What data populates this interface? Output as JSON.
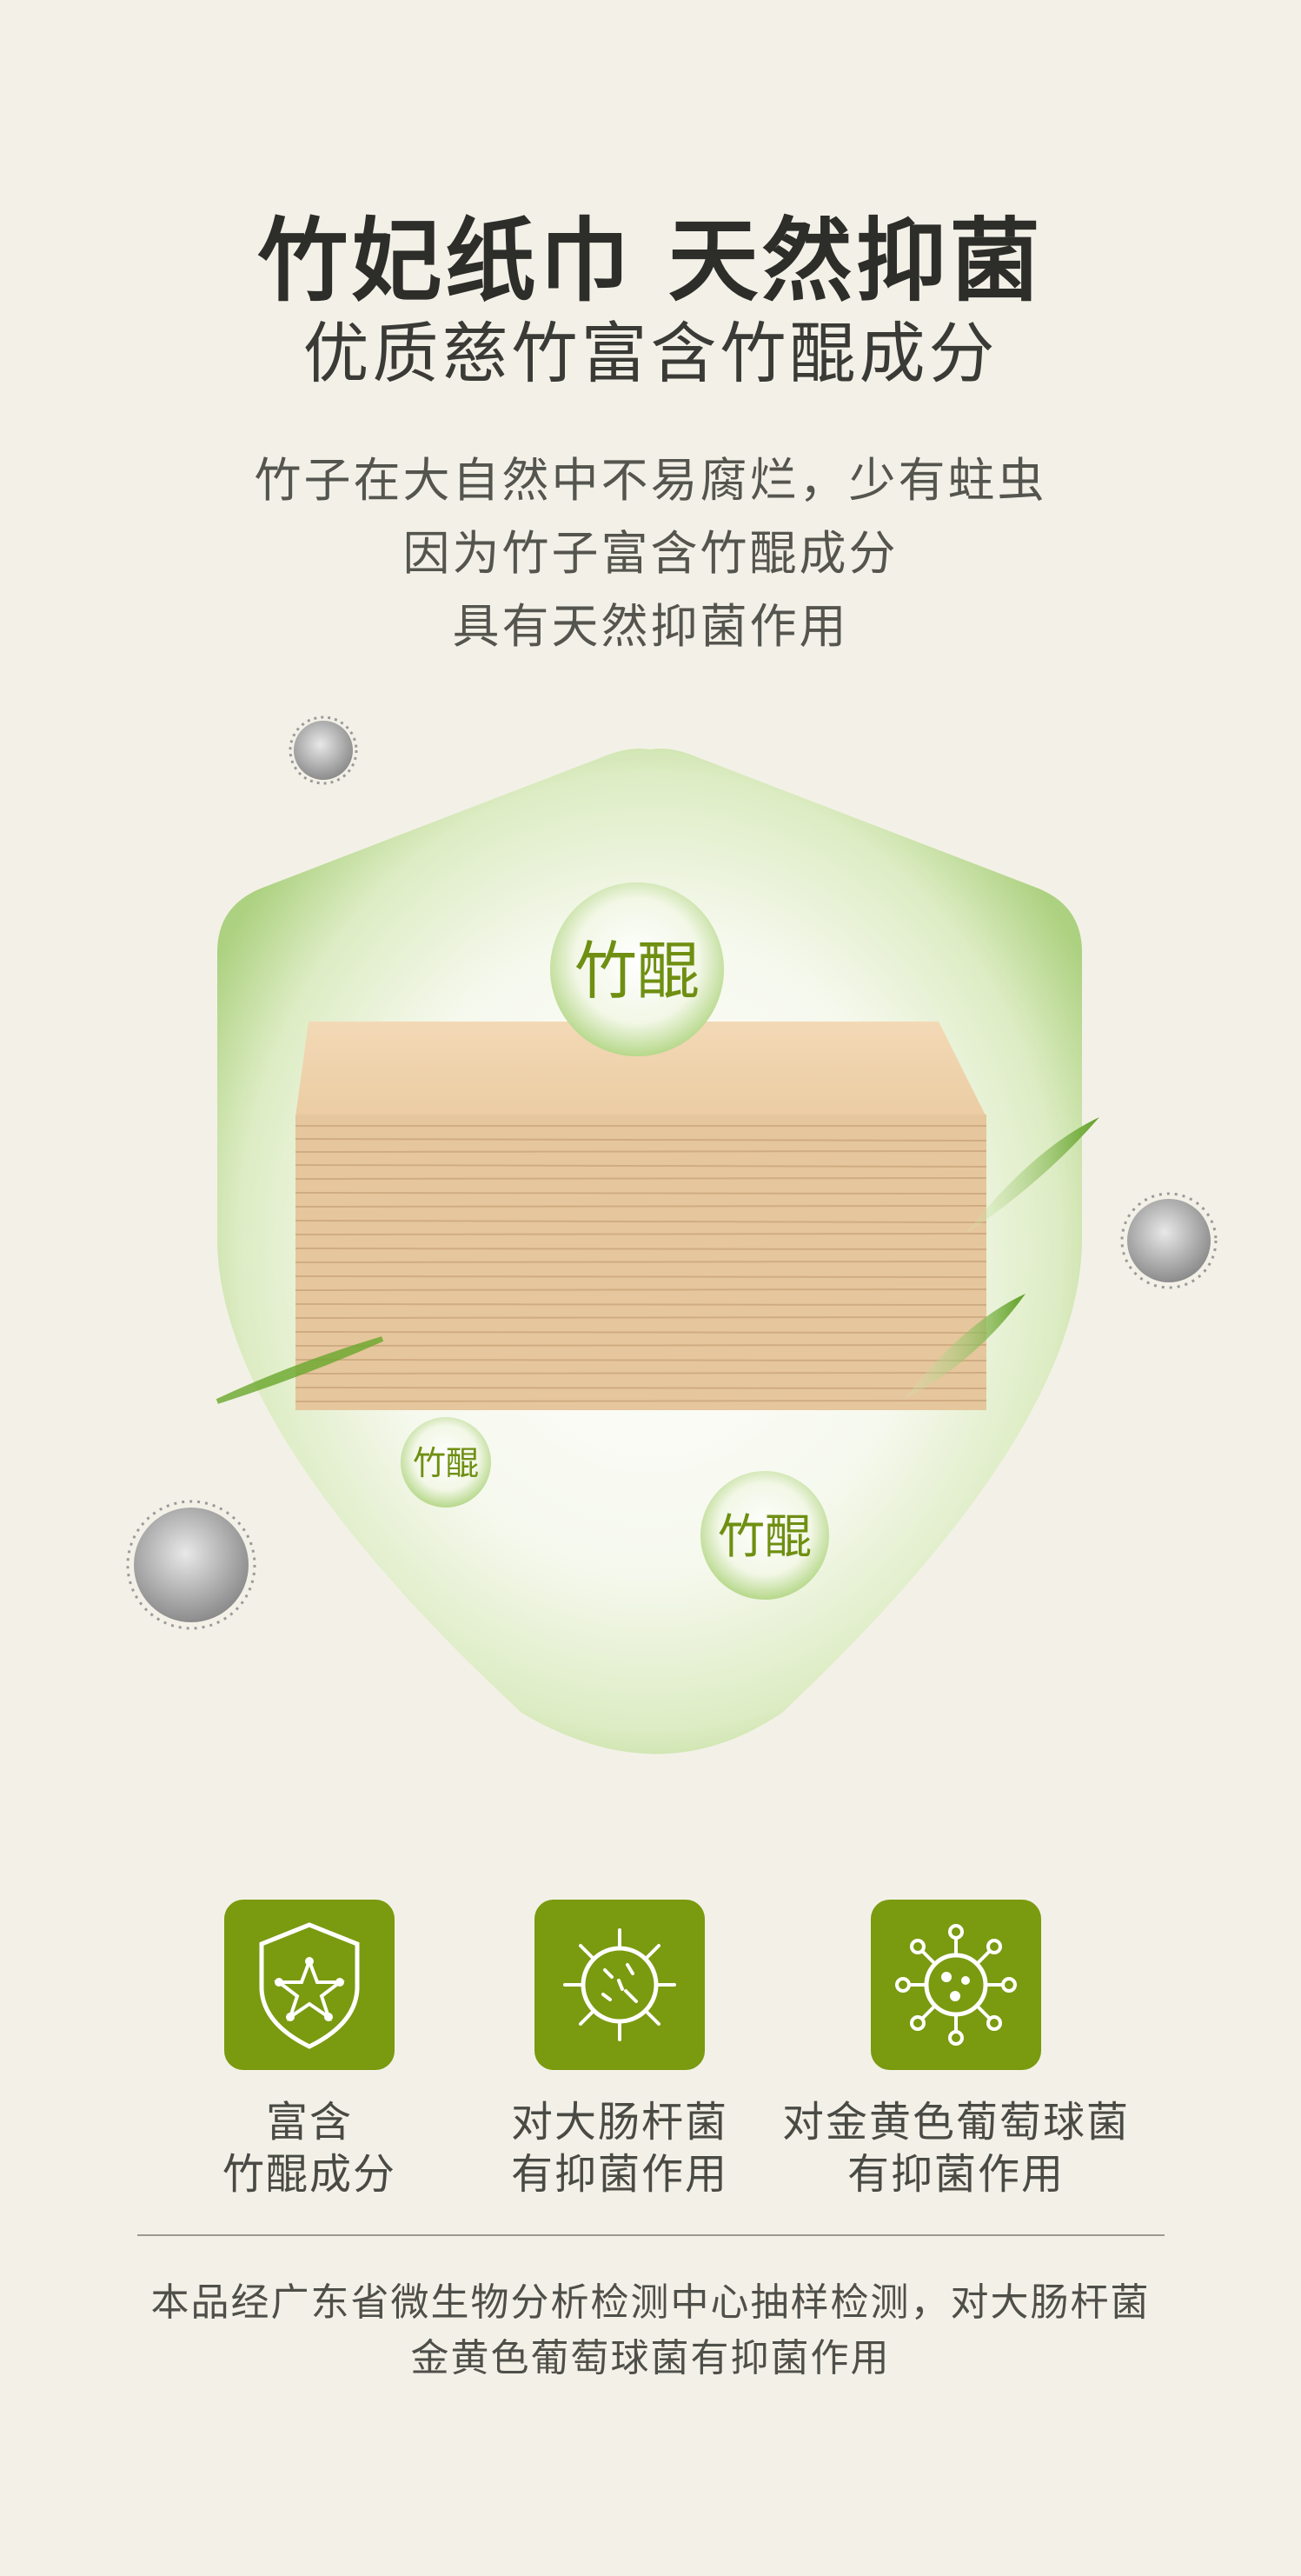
{
  "heading": {
    "title": "竹妃纸巾 天然抑菌",
    "subtitle": "优质慈竹富含竹醌成分"
  },
  "intro": {
    "line1": "竹子在大自然中不易腐烂，少有蛀虫",
    "line2": "因为竹子富含竹醌成分",
    "line3": "具有天然抑菌作用"
  },
  "bubbles": {
    "large": "竹醌",
    "small": "竹醌",
    "medium": "竹醌"
  },
  "features": [
    {
      "icon": "shield-star-icon",
      "line1": "富含",
      "line2": "竹醌成分"
    },
    {
      "icon": "bacteria-icon",
      "line1": "对大肠杆菌",
      "line2": "有抑菌作用"
    },
    {
      "icon": "virus-icon",
      "line1": "对金黄色葡萄球菌",
      "line2": "有抑菌作用"
    }
  ],
  "footnote": {
    "line1": "本品经广东省微生物分析检测中心抽样检测，对大肠杆菌",
    "line2": "金黄色葡萄球菌有抑菌作用"
  },
  "colors": {
    "background": "#f3f1e7",
    "accent_green": "#7a9a10",
    "bubble_text": "#6f8f12",
    "tissue": "#e8c9a2"
  }
}
